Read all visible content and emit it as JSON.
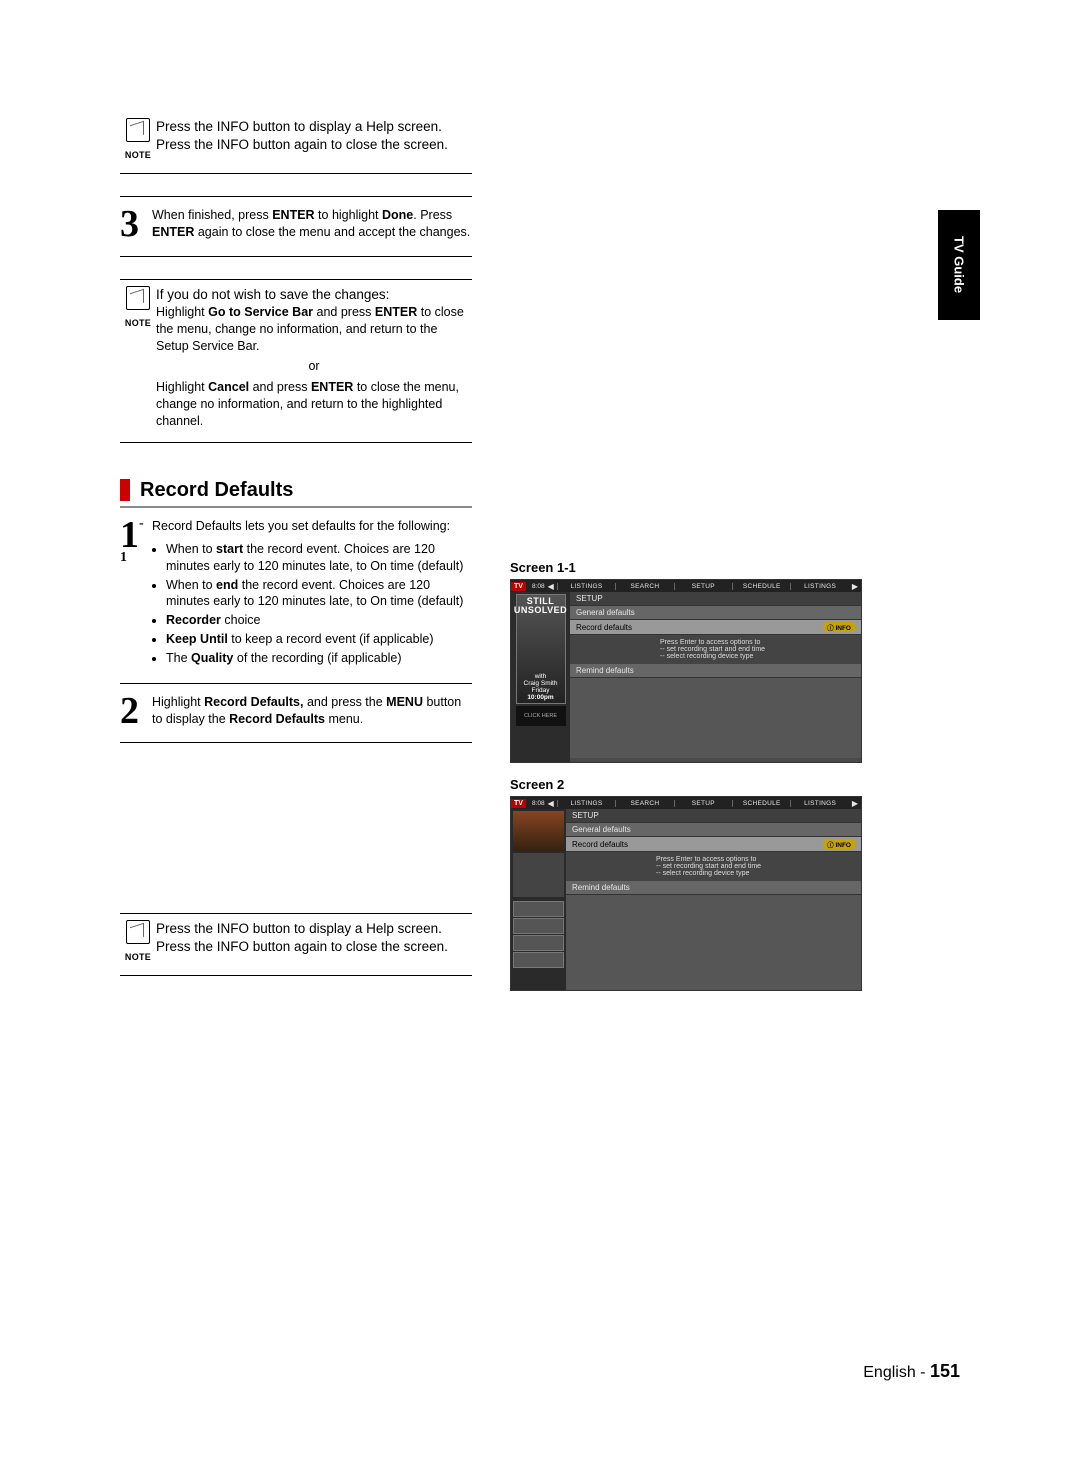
{
  "sidetab": "TV Guide",
  "note1": "Press the INFO button to display a Help screen. Press the INFO button again to close the screen.",
  "note_label": "NOTE",
  "step3": {
    "num": "3",
    "text_before": "When finished, press ",
    "b1": "ENTER",
    "text_mid1": " to highlight ",
    "b2": "Done",
    "text_mid2": ". Press ",
    "b3": "ENTER",
    "text_after": " again to close the menu and accept the changes."
  },
  "note2": {
    "intro": "If you do not wish to save the changes:",
    "line1_pre": "Highlight ",
    "line1_b1": "Go to Service Bar",
    "line1_mid": " and press ",
    "line1_b2": "ENTER",
    "line1_post": " to close the menu, change no information, and return to the Setup Service Bar.",
    "or": "or",
    "line2_pre": "Highlight ",
    "line2_b1": "Cancel",
    "line2_mid": " and press ",
    "line2_b2": "ENTER",
    "line2_post": " to close the menu, change no information, and return to the highlighted channel."
  },
  "heading": "Record Defaults",
  "step1": {
    "num": "1",
    "sub": "-1",
    "intro": "Record Defaults lets you set defaults for the following:",
    "bullets": [
      {
        "pre": "When to ",
        "b": "start",
        "post": " the record event. Choices are 120 minutes early to 120 minutes late, to On time (default)"
      },
      {
        "pre": "When to ",
        "b": "end",
        "post": " the record event. Choices are 120 minutes early to 120 minutes late, to On time (default)"
      },
      {
        "pre": "",
        "b": "Recorder",
        "post": " choice"
      },
      {
        "pre": "",
        "b": "Keep Until",
        "post": " to keep a record event (if applicable)"
      },
      {
        "pre": "The ",
        "b": "Quality",
        "post": " of the recording (if applicable)"
      }
    ]
  },
  "step2": {
    "num": "2",
    "pre": "Highlight ",
    "b1": "Record Defaults,",
    "mid": " and press the ",
    "b2": "MENU",
    "mid2": " button to display the ",
    "b3": "Record Defaults",
    "post": " menu."
  },
  "note3": "Press the INFO button to display a Help screen. Press the INFO button again to close the screen.",
  "screens": {
    "label1": "Screen 1-1",
    "label2": "Screen 2",
    "tv": {
      "logo": "TV",
      "time": "8:08",
      "tabs": [
        "LISTINGS",
        "SEARCH",
        "SETUP",
        "SCHEDULE",
        "LISTINGS"
      ],
      "setup": "SETUP",
      "general": "General defaults",
      "record": "Record defaults",
      "remind": "Remind defaults",
      "info_badge": "ⓘ INFO",
      "desc_l1": "Press Enter to access options to",
      "desc_l2": "-- set recording start and end time",
      "desc_l3": "-- select recording device type",
      "poster_top_1": "STILL",
      "poster_top_2": "UNSOLVED",
      "poster_with": "with",
      "poster_name": "Craig Smith",
      "poster_day": "Friday",
      "poster_time": "10:00pm",
      "click_here": "CLICK HERE"
    }
  },
  "footer": {
    "lang": "English - ",
    "page": "151"
  }
}
